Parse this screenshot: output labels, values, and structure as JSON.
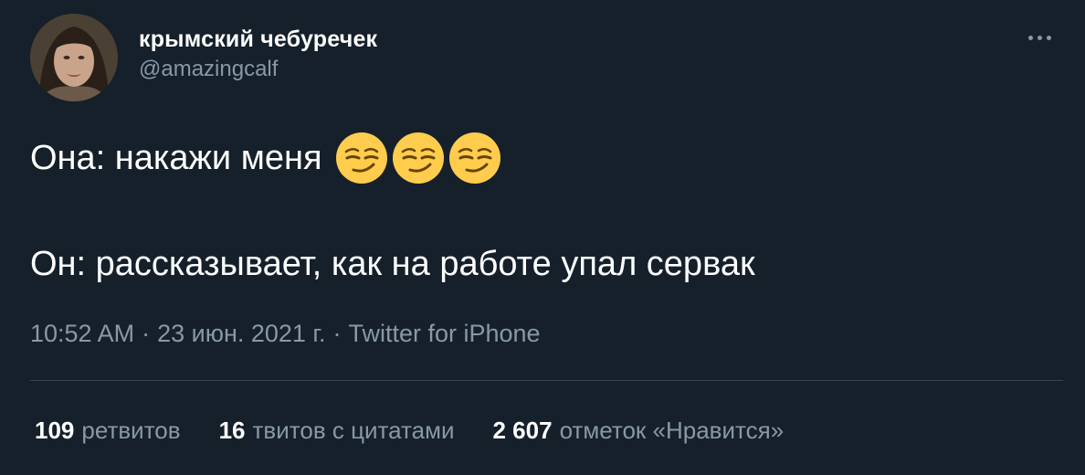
{
  "author": {
    "display_name": "крымский чебуречек",
    "handle": "@amazingcalf"
  },
  "tweet": {
    "line1_text": "Она: накажи меня",
    "line1_emojis": [
      "smirking-face-emoji",
      "smirking-face-emoji",
      "smirking-face-emoji"
    ],
    "line2_text": "Он: рассказывает, как на работе упал сервак"
  },
  "meta": {
    "time": "10:52 AM",
    "separator": "·",
    "date": "23 июн. 2021 г.",
    "source": "Twitter for iPhone"
  },
  "stats": {
    "retweets_count": "109",
    "retweets_label": "ретвитов",
    "quotes_count": "16",
    "quotes_label": "твитов с цитатами",
    "likes_count": "2 607",
    "likes_label": "отметок «Нравится»"
  },
  "colors": {
    "background": "#15202b",
    "primary_text": "#ffffff",
    "secondary_text": "#8899a6",
    "divider": "#38444d",
    "emoji_yellow": "#ffcc4d"
  },
  "icons": {
    "more": "more-horizontal-icon"
  }
}
